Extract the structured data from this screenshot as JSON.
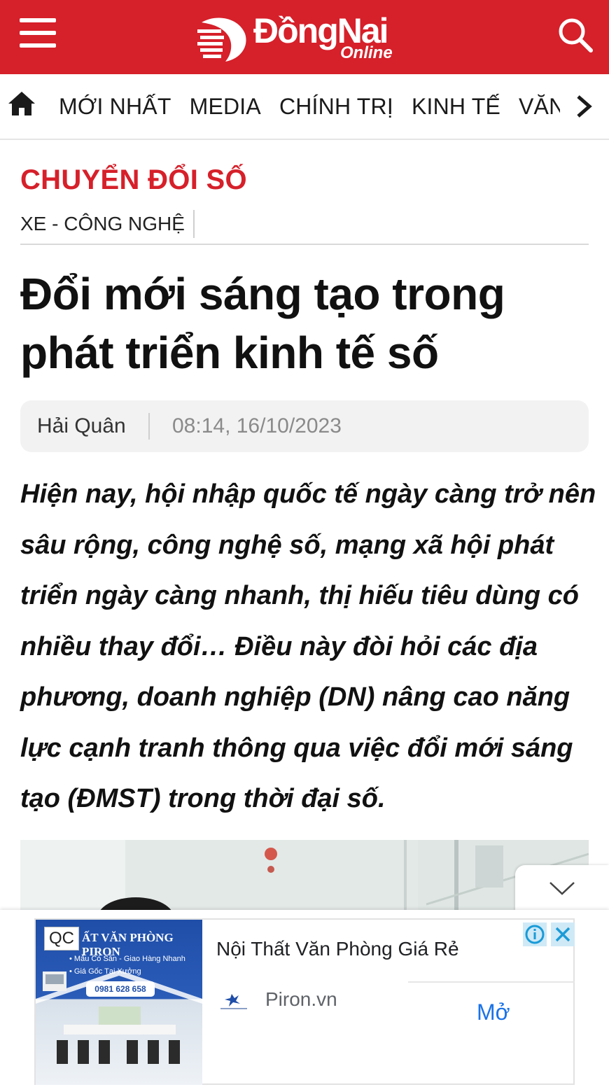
{
  "header": {
    "logo_text": "ĐồngNai",
    "logo_sub": "Online"
  },
  "nav": {
    "items": [
      {
        "label": "MỚI NHẤT"
      },
      {
        "label": "MEDIA"
      },
      {
        "label": "CHÍNH TRỊ"
      },
      {
        "label": "KINH TẾ"
      },
      {
        "label": "VĂN H"
      }
    ]
  },
  "article": {
    "category": "CHUYỂN ĐỔI SỐ",
    "subcategory": "XE - CÔNG NGHỆ",
    "title": "Đổi mới sáng tạo trong phát triển kinh tế số",
    "author": "Hải Quân",
    "date": "08:14, 16/10/2023",
    "sapo": "Hiện nay, hội nhập quốc tế ngày càng trở nên sâu rộng, công nghệ số, mạng xã hội phát triển ngày càng nhanh, thị hiếu tiêu dùng có nhiều thay đổi… Điều này đòi hỏi các địa phương, doanh nghiệp (DN) nâng cao năng lực cạnh tranh thông qua việc đổi mới sáng tạo (ĐMST) trong thời đại số."
  },
  "ad": {
    "badge": "QC",
    "image_title": "ẤT VĂN PHÒNG PIRON",
    "image_line1": "• Mẫu Có Sẵn - Giao Hàng Nhanh",
    "image_line2": "• Giá Gốc Tại Xưởng",
    "image_phone": "0981 628 658",
    "title": "Nội Thất Văn Phòng Giá Rẻ",
    "source": "Piron.vn",
    "cta": "Mở"
  },
  "colors": {
    "brand_red": "#d6202a",
    "link_blue": "#1a73e8"
  },
  "icons": [
    "menu-icon",
    "search-icon",
    "home-icon",
    "chevron-right-icon",
    "chevron-down-icon",
    "info-icon",
    "close-icon"
  ]
}
